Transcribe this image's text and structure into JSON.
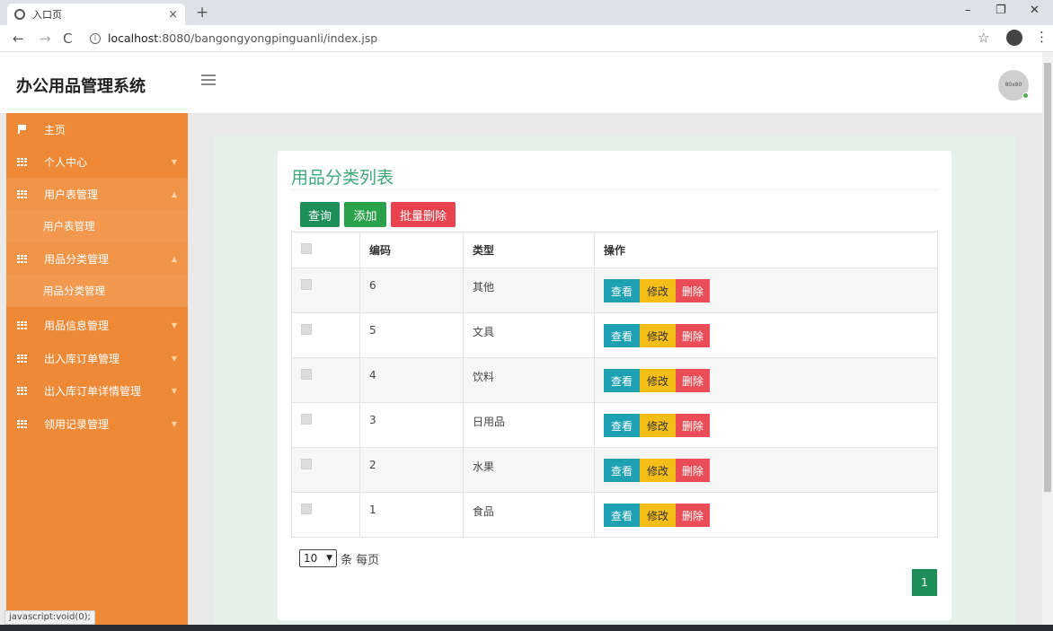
{
  "browser": {
    "tab_title": "入口页",
    "tab_close": "×",
    "new_tab": "+",
    "url_host": "localhost",
    "url_rest": ":8080/bangongyongpinguanli/index.jsp",
    "status_text": "javascript:void(0);",
    "win_min": "–",
    "win_max": "❐",
    "win_close": "✕"
  },
  "header": {
    "brand": "办公用品管理系统",
    "avatar_text": "80x80"
  },
  "sidebar": {
    "items": [
      {
        "label": "主页",
        "icon": "flag-icon"
      },
      {
        "label": "个人中心",
        "icon": "grid-icon"
      },
      {
        "label": "用户表管理",
        "icon": "grid-icon"
      },
      {
        "label": "用户表管理"
      },
      {
        "label": "用品分类管理",
        "icon": "grid-icon"
      },
      {
        "label": "用品分类管理"
      },
      {
        "label": "用品信息管理",
        "icon": "grid-icon"
      },
      {
        "label": "出入库订单管理",
        "icon": "grid-icon"
      },
      {
        "label": "出入库订单详情管理",
        "icon": "grid-icon"
      },
      {
        "label": "领用记录管理",
        "icon": "grid-icon"
      }
    ]
  },
  "main": {
    "title": "用品分类列表",
    "buttons": {
      "query": "查询",
      "add": "添加",
      "batch_delete": "批量删除"
    },
    "table": {
      "headers": [
        "编码",
        "类型",
        "操作"
      ],
      "rows": [
        {
          "code": "6",
          "type": "其他"
        },
        {
          "code": "5",
          "type": "文具"
        },
        {
          "code": "4",
          "type": "饮料"
        },
        {
          "code": "3",
          "type": "日用品"
        },
        {
          "code": "2",
          "type": "水果"
        },
        {
          "code": "1",
          "type": "食品"
        }
      ],
      "actions": {
        "view": "查看",
        "edit": "修改",
        "delete": "删除"
      }
    },
    "page_size": "10",
    "page_size_suffix": "条 每页",
    "current_page": "1"
  },
  "colors": {
    "sidebar": "#ee8a37",
    "title_green": "#3fa878",
    "primary_green": "#1d8e57",
    "danger": "#e8434f",
    "info": "#1ea2b3",
    "warning": "#f4bd17"
  }
}
